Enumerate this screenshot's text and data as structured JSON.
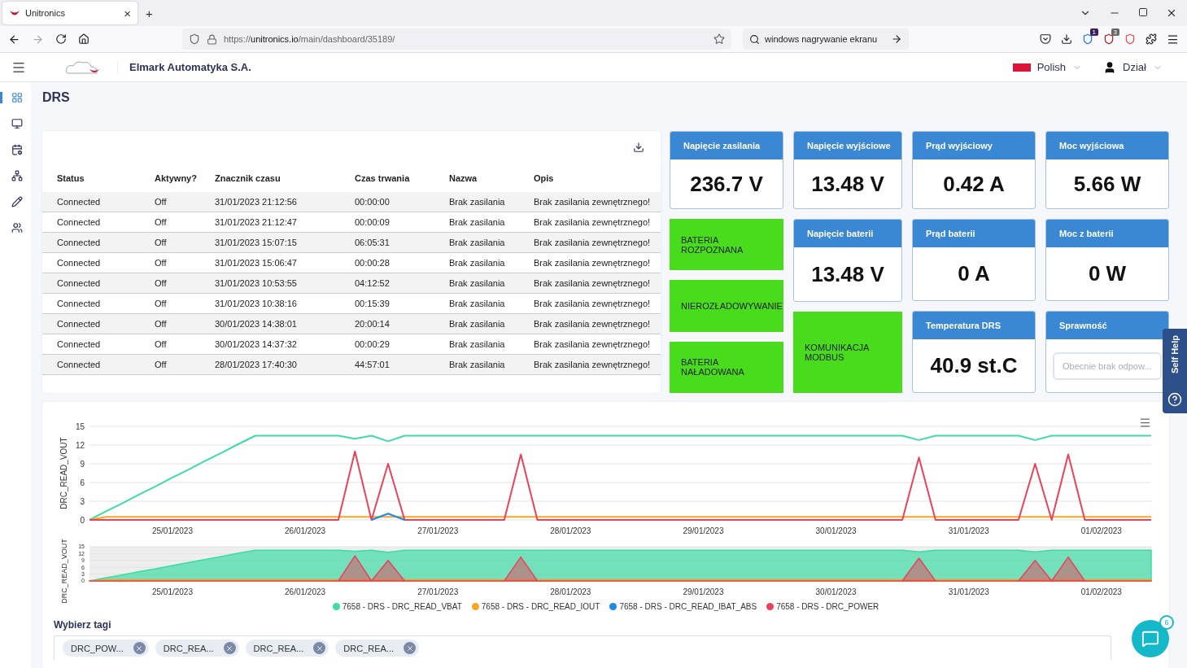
{
  "browser": {
    "tab_title": "Unitronics",
    "tab_close": "×",
    "new_tab": "+",
    "url": "https://**unitronics.io**/main/dashboard/35189/",
    "search_text": "windows nagrywanie ekranu",
    "extension_badges": [
      "1",
      "3"
    ]
  },
  "header": {
    "company": "Elmark Automatyka S.A.",
    "language": "Polish",
    "user": "Dział"
  },
  "sidebar": {
    "items": [
      {
        "selected": true
      },
      {
        "selected": false
      },
      {
        "selected": false
      },
      {
        "selected": false
      },
      {
        "selected": false
      },
      {
        "selected": false
      }
    ]
  },
  "page_title": "DRS",
  "table": {
    "columns": [
      "Status",
      "Aktywny?",
      "Znacznik czasu",
      "Czas trwania",
      "Nazwa",
      "Opis"
    ],
    "rows": [
      [
        "Connected",
        "Off",
        "31/01/2023 21:12:56",
        "00:00:00",
        "Brak zasilania",
        "Brak zasilania zewnętrznego!"
      ],
      [
        "Connected",
        "Off",
        "31/01/2023 21:12:47",
        "00:00:09",
        "Brak zasilania",
        "Brak zasilania zewnętrznego!"
      ],
      [
        "Connected",
        "Off",
        "31/01/2023 15:07:15",
        "06:05:31",
        "Brak zasilania",
        "Brak zasilania zewnętrznego!"
      ],
      [
        "Connected",
        "Off",
        "31/01/2023 15:06:47",
        "00:00:28",
        "Brak zasilania",
        "Brak zasilania zewnętrznego!"
      ],
      [
        "Connected",
        "Off",
        "31/01/2023 10:53:55",
        "04:12:52",
        "Brak zasilania",
        "Brak zasilania zewnętrznego!"
      ],
      [
        "Connected",
        "Off",
        "31/01/2023 10:38:16",
        "00:15:39",
        "Brak zasilania",
        "Brak zasilania zewnętrznego!"
      ],
      [
        "Connected",
        "Off",
        "30/01/2023 14:38:01",
        "20:00:14",
        "Brak zasilania",
        "Brak zasilania zewnętrznego!"
      ],
      [
        "Connected",
        "Off",
        "30/01/2023 14:37:32",
        "00:00:29",
        "Brak zasilania",
        "Brak zasilania zewnętrznego!"
      ],
      [
        "Connected",
        "Off",
        "28/01/2023 17:40:30",
        "44:57:01",
        "Brak zasilania",
        "Brak zasilania zewnętrznego!"
      ]
    ]
  },
  "tile_columns": [
    [
      {
        "kind": "metric",
        "title": "Napięcie zasilania",
        "value": "236.7 V"
      },
      {
        "kind": "status",
        "label": "BATERIA\nROZPOZNANA",
        "color": "#48dc1c"
      },
      {
        "kind": "status",
        "label": "NIEROZŁADOWYWANIE",
        "color": "#48dc1c"
      },
      {
        "kind": "status",
        "label": "BATERIA\nNAŁADOWANA",
        "color": "#48dc1c"
      }
    ],
    [
      {
        "kind": "metric",
        "title": "Napięcie wyjściowe",
        "value": "13.48 V"
      },
      {
        "kind": "metric",
        "title": "Napięcie baterii",
        "value": "13.48 V"
      },
      {
        "kind": "status",
        "label": "KOMUNIKACJA\nMODBUS",
        "color": "#48dc1c"
      }
    ],
    [
      {
        "kind": "metric",
        "title": "Prąd wyjściowy",
        "value": "0.42 A"
      },
      {
        "kind": "metric",
        "title": "Prąd baterii",
        "value": "0 A"
      },
      {
        "kind": "metric",
        "title": "Temperatura DRS",
        "value": "40.9 st.C"
      }
    ],
    [
      {
        "kind": "metric",
        "title": "Moc wyjściowa",
        "value": "5.66 W"
      },
      {
        "kind": "metric",
        "title": "Moc z baterii",
        "value": "0 W"
      },
      {
        "kind": "input",
        "title": "Sprawność",
        "placeholder": "Obecnie brak odpow..."
      }
    ]
  ],
  "chart": {
    "chart_data": {
      "type": "line",
      "ylabel": "DRC_READ_VOUT",
      "grid": true,
      "ylim": [
        0,
        15
      ],
      "yticks": [
        0,
        3,
        6,
        9,
        12,
        15
      ],
      "categories": [
        null,
        null,
        null,
        null,
        null,
        "25/01/2023",
        null,
        null,
        null,
        null,
        null,
        null,
        null,
        "26/01/2023",
        null,
        null,
        null,
        null,
        null,
        null,
        null,
        "27/01/2023",
        null,
        null,
        null,
        null,
        null,
        null,
        null,
        "28/01/2023",
        null,
        null,
        null,
        null,
        null,
        null,
        null,
        "29/01/2023",
        null,
        null,
        null,
        null,
        null,
        null,
        null,
        "30/01/2023",
        null,
        null,
        null,
        null,
        null,
        null,
        null,
        "31/01/2023",
        null,
        null,
        null,
        null,
        null,
        null,
        null,
        "01/02/2023",
        null,
        null,
        null
      ],
      "series": [
        {
          "name": "7658 - DRS - DRC_READ_VBAT",
          "color": "#3ddba6",
          "values": [
            0,
            1.4,
            2.7,
            4.1,
            5.4,
            6.8,
            8.1,
            9.5,
            10.8,
            12.2,
            13.5,
            13.5,
            13.5,
            13.5,
            13.5,
            13.5,
            13.0,
            13.5,
            12.6,
            13.5,
            13.5,
            13.5,
            13.5,
            13.5,
            13.5,
            13.5,
            13.5,
            13.5,
            13.5,
            13.5,
            13.5,
            13.5,
            13.5,
            13.5,
            13.5,
            13.5,
            13.5,
            13.5,
            13.5,
            13.5,
            13.5,
            13.5,
            13.5,
            13.5,
            13.5,
            13.5,
            13.5,
            13.5,
            13.5,
            13.5,
            12.8,
            13.5,
            13.5,
            13.5,
            13.5,
            13.5,
            13.5,
            12.8,
            13.5,
            13.5,
            13.5,
            13.5,
            13.5,
            13.5,
            13.5
          ]
        },
        {
          "name": "7658 - DRS - DRC_READ_IOUT",
          "color": "#f5a623",
          "values": [
            0,
            0.5,
            0.5,
            0.5,
            0.5,
            0.5,
            0.5,
            0.5,
            0.5,
            0.5,
            0.5,
            0.5,
            0.5,
            0.5,
            0.5,
            0.5,
            0.5,
            0.5,
            0.5,
            0.5,
            0.5,
            0.5,
            0.5,
            0.5,
            0.5,
            0.5,
            0.5,
            0.5,
            0.5,
            0.5,
            0.5,
            0.5,
            0.5,
            0.5,
            0.5,
            0.5,
            0.5,
            0.5,
            0.5,
            0.5,
            0.5,
            0.5,
            0.5,
            0.5,
            0.5,
            0.5,
            0.5,
            0.5,
            0.5,
            0.5,
            0.5,
            0.5,
            0.5,
            0.5,
            0.5,
            0.5,
            0.5,
            0.5,
            0.5,
            0.5,
            0.5,
            0.5,
            0.5,
            0.5,
            0.5
          ]
        },
        {
          "name": "7658 - DRS - DRC_READ_IBAT_ABS",
          "color": "#1e88e5",
          "values": [
            null,
            null,
            null,
            null,
            null,
            null,
            null,
            null,
            null,
            null,
            null,
            null,
            null,
            null,
            null,
            null,
            null,
            0,
            1,
            0,
            null,
            null,
            null,
            null,
            null,
            null,
            null,
            null,
            null,
            null,
            null,
            null,
            null,
            null,
            null,
            null,
            null,
            null,
            null,
            null,
            null,
            null,
            null,
            null,
            null,
            null,
            null,
            null,
            null,
            null,
            null,
            null,
            null,
            null,
            null,
            null,
            null,
            null,
            null,
            null,
            null,
            null,
            null,
            null,
            null
          ]
        },
        {
          "name": "7658 - DRS - DRC_POWER",
          "color": "#e8435a",
          "values": [
            0,
            0,
            0,
            0,
            0,
            0,
            0,
            0,
            0,
            0,
            0,
            0,
            0,
            0,
            0,
            0,
            11,
            0,
            9,
            0,
            0,
            0,
            0,
            0,
            0,
            0,
            10.5,
            0,
            0,
            0,
            0,
            0,
            0,
            0,
            0,
            0,
            0,
            0,
            0,
            0,
            0,
            0,
            0,
            0,
            0,
            0,
            0,
            0,
            0,
            0,
            10,
            0,
            0,
            0,
            0,
            0,
            0,
            9,
            0,
            10.5,
            0,
            0,
            0,
            0,
            0
          ]
        }
      ]
    },
    "navigator": {
      "chart_data": {
        "type": "area",
        "ylabel": "DRC_READ_VOUT",
        "grid": true,
        "ylim": [
          0,
          15
        ],
        "yticks": [
          0,
          3,
          6,
          9,
          12,
          15
        ],
        "categories": [
          null,
          null,
          null,
          null,
          null,
          "25/01/2023",
          null,
          null,
          null,
          null,
          null,
          null,
          null,
          "26/01/2023",
          null,
          null,
          null,
          null,
          null,
          null,
          null,
          "27/01/2023",
          null,
          null,
          null,
          null,
          null,
          null,
          null,
          "28/01/2023",
          null,
          null,
          null,
          null,
          null,
          null,
          null,
          "29/01/2023",
          null,
          null,
          null,
          null,
          null,
          null,
          null,
          "30/01/2023",
          null,
          null,
          null,
          null,
          null,
          null,
          null,
          "31/01/2023",
          null,
          null,
          null,
          null,
          null,
          null,
          null,
          "01/02/2023",
          null,
          null,
          null
        ],
        "series": [
          {
            "color": "#3ddba6",
            "values": [
              0,
              1.4,
              2.7,
              4.1,
              5.4,
              6.8,
              8.1,
              9.5,
              10.8,
              12.2,
              13.5,
              13.5,
              13.5,
              13.5,
              13.5,
              13.5,
              13.0,
              13.5,
              12.6,
              13.5,
              13.5,
              13.5,
              13.5,
              13.5,
              13.5,
              13.5,
              13.5,
              13.5,
              13.5,
              13.5,
              13.5,
              13.5,
              13.5,
              13.5,
              13.5,
              13.5,
              13.5,
              13.5,
              13.5,
              13.5,
              13.5,
              13.5,
              13.5,
              13.5,
              13.5,
              13.5,
              13.5,
              13.5,
              13.5,
              13.5,
              12.8,
              13.5,
              13.5,
              13.5,
              13.5,
              13.5,
              13.5,
              12.8,
              13.5,
              13.5,
              13.5,
              13.5,
              13.5,
              13.5,
              13.5
            ]
          },
          {
            "color": "#f5a623",
            "values": [
              0,
              0.5,
              0.5,
              0.5,
              0.5,
              0.5,
              0.5,
              0.5,
              0.5,
              0.5,
              0.5,
              0.5,
              0.5,
              0.5,
              0.5,
              0.5,
              0.5,
              0.5,
              0.5,
              0.5,
              0.5,
              0.5,
              0.5,
              0.5,
              0.5,
              0.5,
              0.5,
              0.5,
              0.5,
              0.5,
              0.5,
              0.5,
              0.5,
              0.5,
              0.5,
              0.5,
              0.5,
              0.5,
              0.5,
              0.5,
              0.5,
              0.5,
              0.5,
              0.5,
              0.5,
              0.5,
              0.5,
              0.5,
              0.5,
              0.5,
              0.5,
              0.5,
              0.5,
              0.5,
              0.5,
              0.5,
              0.5,
              0.5,
              0.5,
              0.5,
              0.5,
              0.5,
              0.5,
              0.5,
              0.5
            ]
          },
          {
            "color": "#e8435a",
            "values": [
              0,
              0,
              0,
              0,
              0,
              0,
              0,
              0,
              0,
              0,
              0,
              0,
              0,
              0,
              0,
              0,
              11,
              0,
              9,
              0,
              0,
              0,
              0,
              0,
              0,
              0,
              10.5,
              0,
              0,
              0,
              0,
              0,
              0,
              0,
              0,
              0,
              0,
              0,
              0,
              0,
              0,
              0,
              0,
              0,
              0,
              0,
              0,
              0,
              0,
              0,
              10,
              0,
              0,
              0,
              0,
              0,
              0,
              9,
              0,
              10.5,
              0,
              0,
              0,
              0,
              0
            ]
          }
        ]
      }
    }
  },
  "tags": {
    "label": "Wybierz tagi",
    "chips": [
      "DRC_POW...",
      "DRC_REA...",
      "DRC_REA...",
      "DRC_REA..."
    ]
  },
  "self_help": {
    "label": "Self Help"
  },
  "chat": {
    "badge": "6"
  }
}
